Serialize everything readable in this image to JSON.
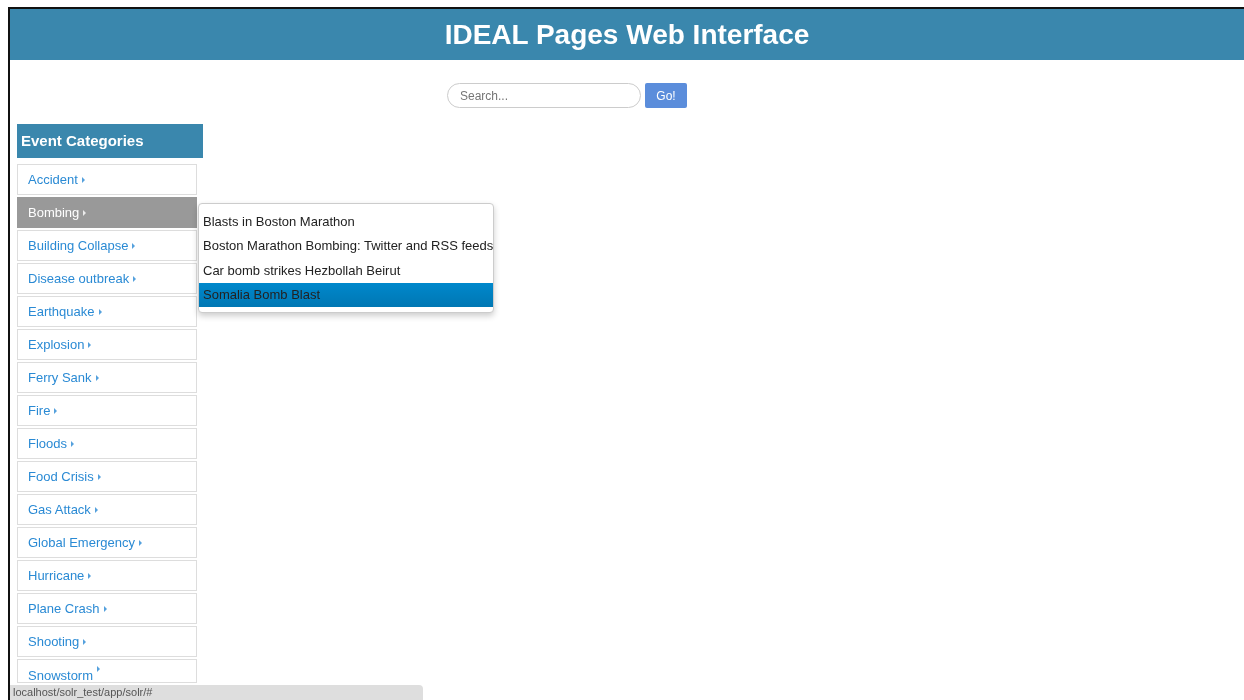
{
  "header": {
    "title": "IDEAL Pages Web Interface"
  },
  "search": {
    "placeholder": "Search...",
    "button": "Go!"
  },
  "sidebar": {
    "title": "Event Categories",
    "items": [
      {
        "label": "Accident",
        "selected": false
      },
      {
        "label": "Bombing",
        "selected": true,
        "submenu": [
          {
            "label": "Blasts in Boston Marathon",
            "selected": false
          },
          {
            "label": "Boston Marathon Bombing: Twitter and RSS feeds",
            "selected": false
          },
          {
            "label": "Car bomb strikes Hezbollah Beirut",
            "selected": false
          },
          {
            "label": "Somalia Bomb Blast",
            "selected": true
          }
        ]
      },
      {
        "label": "Building Collapse",
        "selected": false
      },
      {
        "label": "Disease outbreak",
        "selected": false
      },
      {
        "label": "Earthquake",
        "selected": false
      },
      {
        "label": "Explosion",
        "selected": false
      },
      {
        "label": "Ferry Sank",
        "selected": false
      },
      {
        "label": "Fire",
        "selected": false
      },
      {
        "label": "Floods",
        "selected": false
      },
      {
        "label": "Food Crisis",
        "selected": false
      },
      {
        "label": "Gas Attack",
        "selected": false
      },
      {
        "label": "Global Emergency",
        "selected": false
      },
      {
        "label": "Hurricane",
        "selected": false
      },
      {
        "label": "Plane Crash",
        "selected": false
      },
      {
        "label": "Shooting",
        "selected": false
      },
      {
        "label": "Snowstorm",
        "selected": false
      }
    ]
  },
  "status_bar": {
    "url": "localhost/solr_test/app/solr/#"
  }
}
